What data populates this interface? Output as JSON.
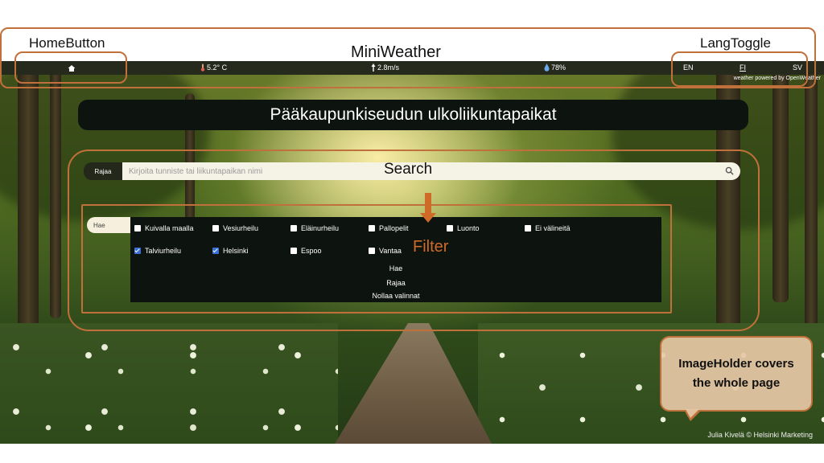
{
  "annotations": {
    "home_button": "HomeButton",
    "mini_weather": "MiniWeather",
    "lang_toggle": "LangToggle",
    "search": "Search",
    "filter": "Filter",
    "image_holder": "ImageHolder covers the whole page"
  },
  "weather": {
    "temperature": "5.2° C",
    "wind": "2.8m/s",
    "humidity": "78%",
    "powered_by": "weather powered by OpenWeather"
  },
  "languages": [
    "EN",
    "FI",
    "SV"
  ],
  "selected_language": "FI",
  "title": "Pääkaupunkiseudun ulkoliikuntapaikat",
  "search": {
    "label": "Rajaa",
    "placeholder": "Kirjoita tunniste tai liikuntapaikan nimi"
  },
  "filter": {
    "tab_label": "Hae",
    "options": [
      {
        "label": "Kuivalla maalla",
        "checked": false
      },
      {
        "label": "Vesiurheilu",
        "checked": false
      },
      {
        "label": "Eläinurheilu",
        "checked": false
      },
      {
        "label": "Pallopelit",
        "checked": false
      },
      {
        "label": "Luonto",
        "checked": false
      },
      {
        "label": "Ei välineitä",
        "checked": false
      },
      {
        "label": "Talviurheilu",
        "checked": true
      },
      {
        "label": "Helsinki",
        "checked": true
      },
      {
        "label": "Espoo",
        "checked": false
      },
      {
        "label": "Vantaa",
        "checked": false
      }
    ],
    "actions": [
      "Hae",
      "Rajaa",
      "Nollaa valinnat"
    ]
  },
  "credit": "Julia Kivelä © Helsinki Marketing",
  "colors": {
    "accent": "#d06a28",
    "annotation_border": "#c0703a",
    "panel_bg": "#0d130e",
    "checkbox_checked": "#3b6fd8"
  },
  "icons": {
    "home": "home-icon",
    "temperature": "thermometer-icon",
    "wind": "wind-arrow-icon",
    "humidity": "droplet-icon",
    "search": "search-icon"
  }
}
